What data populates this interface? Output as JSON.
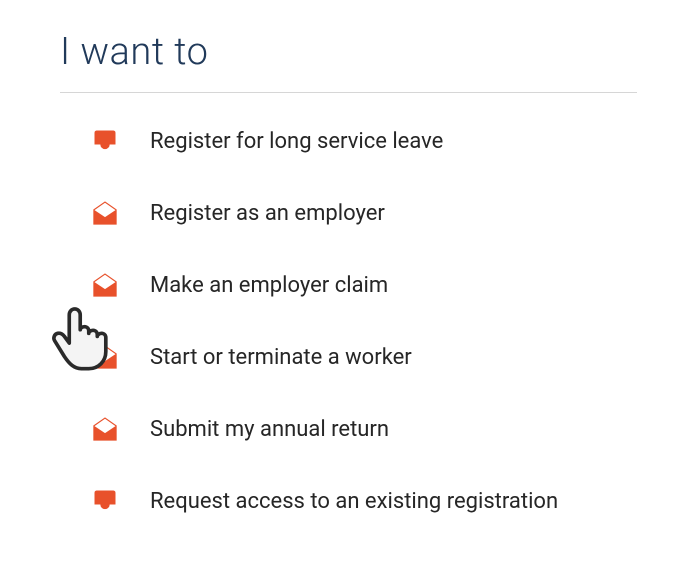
{
  "heading": "I want to",
  "items": [
    {
      "label": "Register for long service leave",
      "icon": "inbox"
    },
    {
      "label": "Register as an employer",
      "icon": "mail-open"
    },
    {
      "label": "Make an employer claim",
      "icon": "mail-open"
    },
    {
      "label": "Start or terminate a worker",
      "icon": "mail-open"
    },
    {
      "label": "Submit my annual return",
      "icon": "mail-open"
    },
    {
      "label": "Request access to an existing registration",
      "icon": "inbox"
    }
  ],
  "colors": {
    "accent": "#e8512b",
    "heading": "#213a5a"
  }
}
